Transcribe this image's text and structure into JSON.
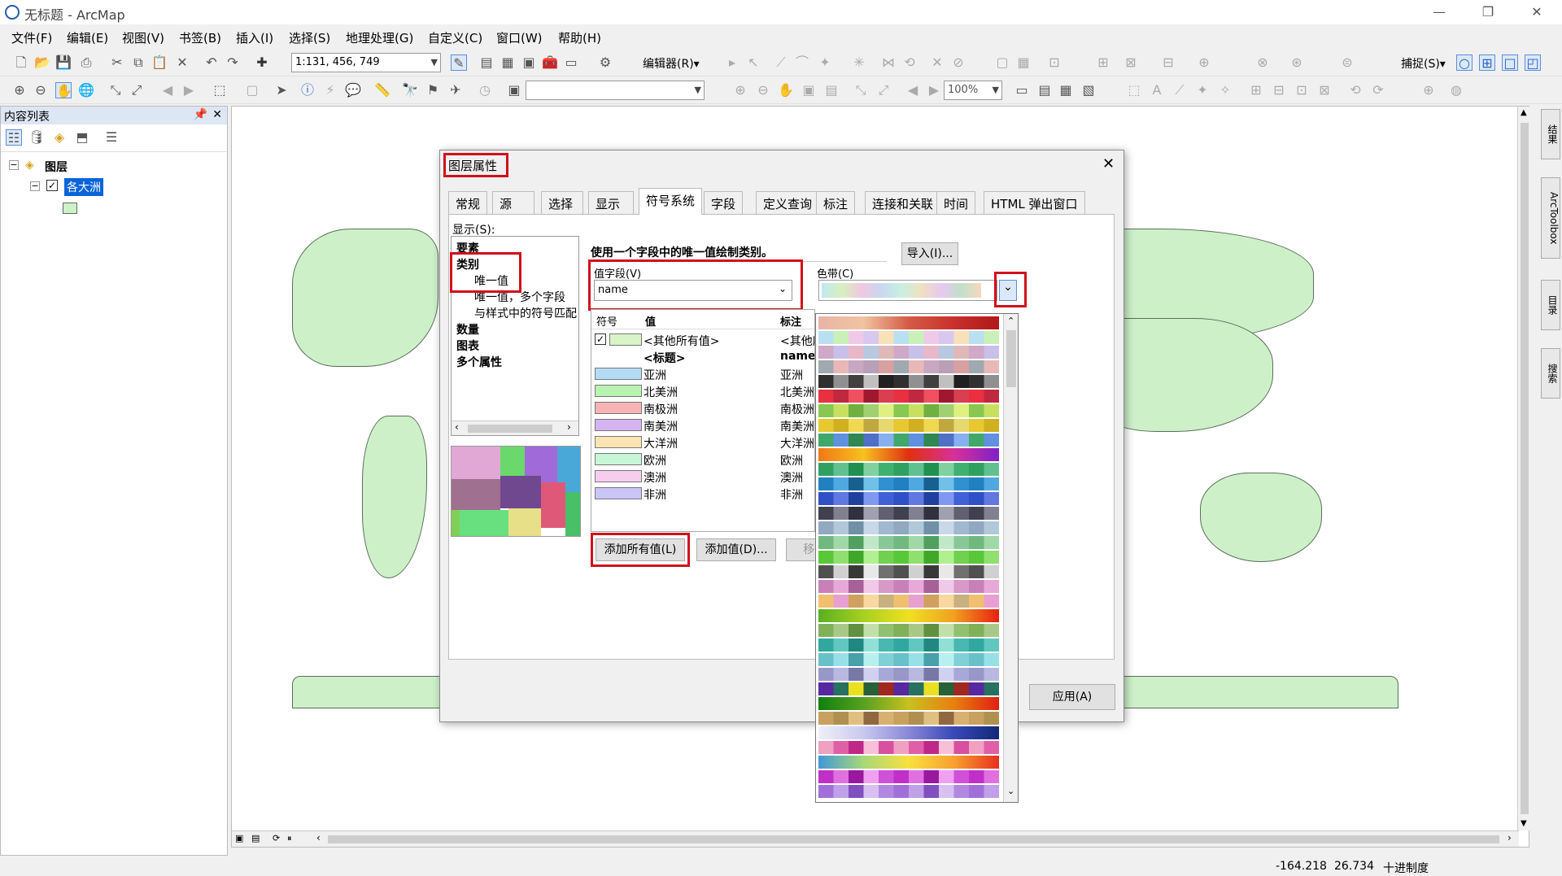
{
  "window": {
    "title": "无标题 - ArcMap"
  },
  "menu": [
    "文件(F)",
    "编辑(E)",
    "视图(V)",
    "书签(B)",
    "插入(I)",
    "选择(S)",
    "地理处理(G)",
    "自定义(C)",
    "窗口(W)",
    "帮助(H)"
  ],
  "toolbar": {
    "scale": "1:131, 456, 749",
    "editor_label": "编辑器(R)▾",
    "zoom": "100%",
    "snap_label": "捕捉(S)▾"
  },
  "toc": {
    "title": "内容列表",
    "root": "图层",
    "layer": "各大洲"
  },
  "right_tabs": [
    "结果",
    "ArcToolbox",
    "目录",
    "搜索"
  ],
  "status": {
    "x": "-164.218",
    "y": "26.734",
    "units": "十进制度"
  },
  "dialog": {
    "title": "图层属性",
    "tabs": [
      "常规",
      "源",
      "选择",
      "显示",
      "符号系统",
      "字段",
      "定义查询",
      "标注",
      "连接和关联",
      "时间",
      "HTML 弹出窗口"
    ],
    "show_label": "显示(S):",
    "show_tree": [
      "要素",
      "类别",
      "唯一值",
      "唯一值，多个字段",
      "与样式中的符号匹配",
      "数量",
      "图表",
      "多个属性"
    ],
    "heading": "使用一个字段中的唯一值绘制类别。",
    "import_btn": "导入(I)...",
    "value_field_label": "值字段(V)",
    "value_field": "name",
    "color_ramp_label": "色带(C)",
    "table_headers": [
      "符号",
      "值",
      "标注"
    ],
    "rows": [
      {
        "color": "#d9f4c6",
        "value": "<其他所有值>",
        "label": "<其他所"
      },
      {
        "color": "",
        "value": "<标题>",
        "label": "name"
      },
      {
        "color": "#b4dcf5",
        "value": "亚洲",
        "label": "亚洲"
      },
      {
        "color": "#b9f3b0",
        "value": "北美洲",
        "label": "北美洲"
      },
      {
        "color": "#f8b4b4",
        "value": "南极洲",
        "label": "南极洲"
      },
      {
        "color": "#d6b4f2",
        "value": "南美洲",
        "label": "南美洲"
      },
      {
        "color": "#fbe4b3",
        "value": "大洋洲",
        "label": "大洋洲"
      },
      {
        "color": "#c7f6d6",
        "value": "欧洲",
        "label": "欧洲"
      },
      {
        "color": "#f7cdee",
        "value": "澳洲",
        "label": "澳洲"
      },
      {
        "color": "#c9c6f7",
        "value": "非洲",
        "label": "非洲"
      }
    ],
    "add_all_btn": "添加所有值(L)",
    "add_value_btn": "添加值(D)...",
    "remove_btn": "移除(",
    "apply_btn": "应用(A)"
  },
  "ramp_colors": [
    [
      "#e8b4a6",
      "#f0c4a0",
      "#d45a46",
      "#c9302c",
      "#b01818"
    ],
    [
      "#b8e0f0",
      "#c8f0b8",
      "#f0c8e8",
      "#d8c8f0",
      "#f8e0b8"
    ],
    [
      "#d0a8c8",
      "#c8c0e8",
      "#e8b8c8",
      "#b8c8e0",
      "#e0b8b8"
    ],
    [
      "#a0a8b0",
      "#e8b8b8",
      "#c8a8c0",
      "#b8a0b8",
      "#d8a0a0"
    ],
    [
      "#303030",
      "#909090",
      "#404040",
      "#c0c0c0",
      "#202020"
    ],
    [
      "#e83040",
      "#c02840",
      "#f05060",
      "#a01830",
      "#d84050"
    ],
    [
      "#88c850",
      "#c8e060",
      "#70b040",
      "#a0d070",
      "#e0f080"
    ],
    [
      "#e8c830",
      "#d0b020",
      "#f0d850",
      "#c0a840",
      "#e8d870"
    ],
    [
      "#40a868",
      "#6090e0",
      "#308850",
      "#5070c8",
      "#88b0f0"
    ],
    [
      "#f07818",
      "#f8c020",
      "#e03010",
      "#d83098",
      "#8020c8"
    ],
    [
      "#30a060",
      "#60c090",
      "#209050",
      "#80d0a0",
      "#40b070"
    ],
    [
      "#2080c0",
      "#50a8e0",
      "#186090",
      "#70c0e8",
      "#3090d0"
    ],
    [
      "#3050c8",
      "#6078e0",
      "#2040a0",
      "#8098f0",
      "#4060d8"
    ],
    [
      "#404050",
      "#808090",
      "#303040",
      "#a0a0b0",
      "#606070"
    ],
    [
      "#90a8c0",
      "#b0c8d8",
      "#7090a8",
      "#c8d8e8",
      "#a0b8d0"
    ],
    [
      "#70b880",
      "#a0d8a8",
      "#50a060",
      "#c0e8c8",
      "#88c898"
    ],
    [
      "#58c838",
      "#90e070",
      "#40a828",
      "#b0f090",
      "#70d050"
    ],
    [
      "#505050",
      "#d0d0d0",
      "#383838",
      "#e8e8e8",
      "#707070"
    ],
    [
      "#c880b8",
      "#e8a8d8",
      "#a86098",
      "#f0c8e8",
      "#d898c8"
    ],
    [
      "#f0c070",
      "#e8a0d0",
      "#d0a060",
      "#f8d8a0",
      "#c8b080"
    ],
    [
      "#58b020",
      "#a8d020",
      "#f0e020",
      "#f0a020",
      "#e82010"
    ],
    [
      "#80b058",
      "#a8c888",
      "#609040",
      "#c0e0a8",
      "#90c070"
    ],
    [
      "#30a8a0",
      "#60c8c0",
      "#208880",
      "#90e0d8",
      "#48b8b0"
    ],
    [
      "#68c0c8",
      "#98e0e8",
      "#48a0a8",
      "#b8f0f0",
      "#80d0d8"
    ],
    [
      "#9898c8",
      "#b8b8e0",
      "#7878a8",
      "#d0d0f0",
      "#a8a8d8"
    ],
    [
      "#5828a0",
      "#287060",
      "#e8e020",
      "#286038",
      "#a02820"
    ],
    [
      "#108010",
      "#58a020",
      "#c8c020",
      "#e88010",
      "#e02010"
    ],
    [
      "#c8a060",
      "#b09050",
      "#e0c080",
      "#906840",
      "#d8b070"
    ],
    [
      "#f0f0f8",
      "#c8c8f0",
      "#8888d8",
      "#3848b8",
      "#102878"
    ],
    [
      "#f0a0c0",
      "#e060a8",
      "#c02888",
      "#f8c0d8",
      "#d850a0"
    ],
    [
      "#4098d8",
      "#a8d878",
      "#f8e040",
      "#f8a030",
      "#e83020"
    ],
    [
      "#c030c8",
      "#e070e0",
      "#9818a0",
      "#f0a0f0",
      "#d050d8"
    ],
    [
      "#a070d8",
      "#c0a0e8",
      "#8050c0",
      "#d8c0f0",
      "#b088e0"
    ]
  ]
}
